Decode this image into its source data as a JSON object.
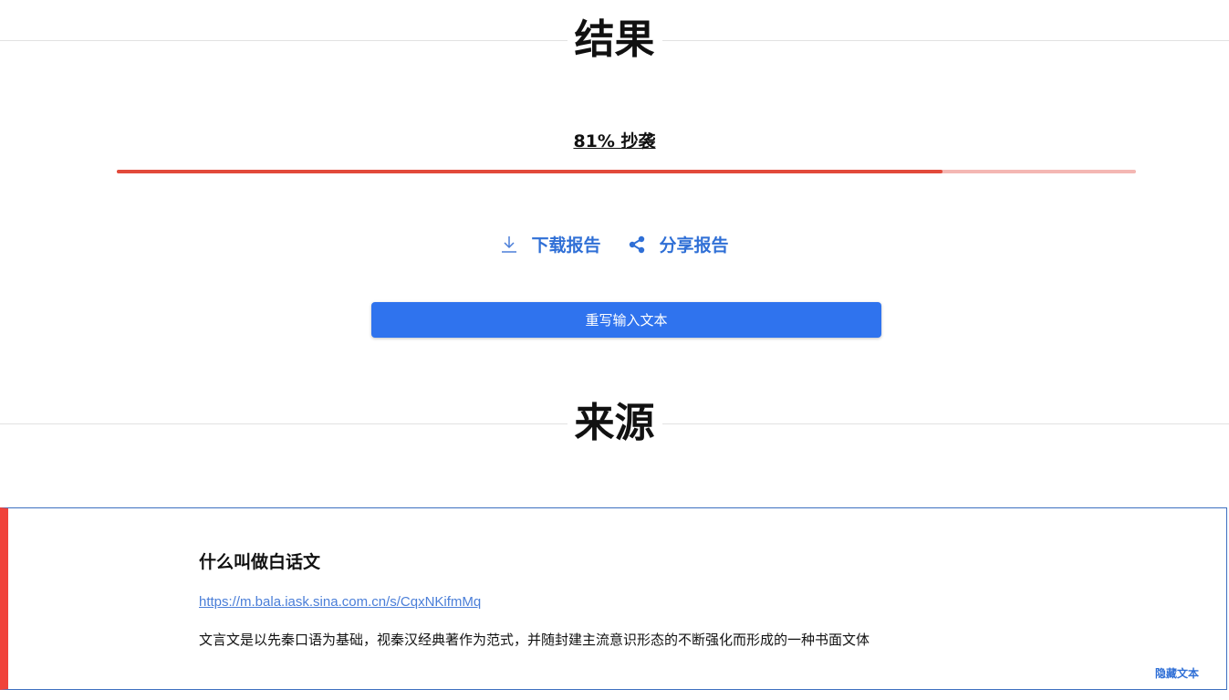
{
  "result": {
    "heading": "结果",
    "score_label": "81% 抄袭",
    "plagiarism_percent": 81
  },
  "actions": {
    "download_label": "下载报告",
    "download_icon": "download-icon",
    "share_label": "分享报告",
    "share_icon": "share-icon"
  },
  "rewrite_button_label": "重写输入文本",
  "sources": {
    "heading": "来源",
    "items": [
      {
        "title": "什么叫做白话文",
        "url": "https://m.bala.iask.sina.com.cn/s/CqxNKifmMq",
        "excerpt": "文言文是以先秦口语为基础，视秦汉经典著作为范式，并随封建主流意识形态的不断强化而形成的一种书面文体",
        "hide_label": "隐藏文本"
      }
    ]
  },
  "colors": {
    "accent_blue": "#2f73ee",
    "link_blue": "#4a7ed8",
    "progress_red": "#e24a3b",
    "progress_track": "#f4b7b3",
    "card_marker_red": "#f0433a"
  }
}
